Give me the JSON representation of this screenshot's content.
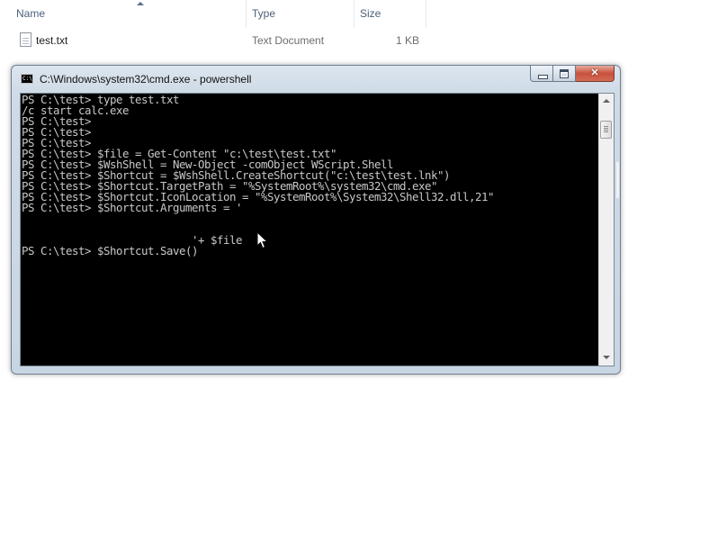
{
  "explorer": {
    "columns": [
      "Name",
      "Type",
      "Size"
    ],
    "files": [
      {
        "name": "test.txt",
        "type": "Text Document",
        "size": "1 KB"
      }
    ]
  },
  "console_window": {
    "title": "C:\\Windows\\system32\\cmd.exe - powershell",
    "icon_label": "C:\\",
    "lines": [
      "PS C:\\test> type test.txt",
      "/c start calc.exe",
      "PS C:\\test>",
      "PS C:\\test>",
      "PS C:\\test>",
      "PS C:\\test> $file = Get-Content \"c:\\test\\test.txt\"",
      "PS C:\\test> $WshShell = New-Object -comObject WScript.Shell",
      "PS C:\\test> $Shortcut = $WshShell.CreateShortcut(\"c:\\test\\test.lnk\")",
      "PS C:\\test> $Shortcut.TargetPath = \"%SystemRoot%\\system32\\cmd.exe\"",
      "PS C:\\test> $Shortcut.IconLocation = \"%SystemRoot%\\System32\\Shell32.dll,21\"",
      "PS C:\\test> $Shortcut.Arguments = '",
      "",
      "",
      "                           '+ $file",
      "PS C:\\test> $Shortcut.Save()"
    ]
  },
  "icons": {
    "file": "text-document-icon",
    "console": "console-icon",
    "cursor": "mouse-pointer-icon"
  },
  "colors": {
    "console_bg": "#000000",
    "console_fg": "#c0c0c0",
    "close_button": "#c8513c"
  }
}
